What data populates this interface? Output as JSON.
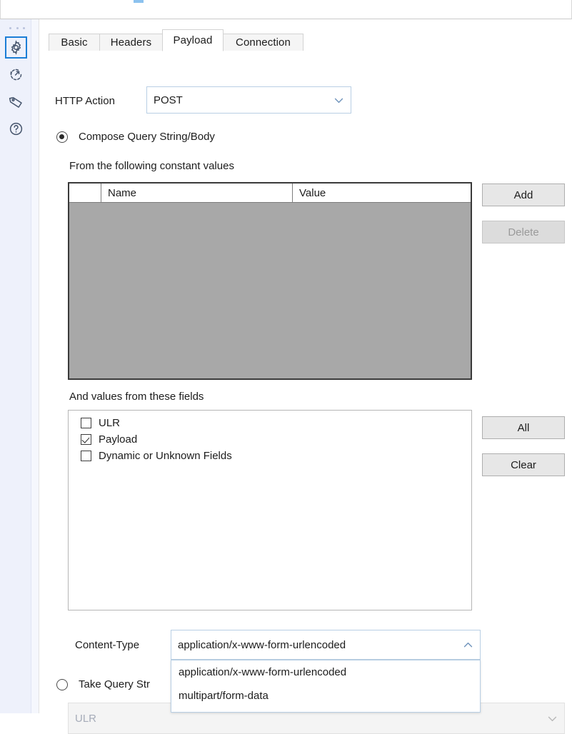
{
  "rail": {
    "handle": "drag-handle-dots",
    "items": [
      {
        "icon": "gear-icon",
        "selected": true
      },
      {
        "icon": "refresh-arrow-icon",
        "selected": false
      },
      {
        "icon": "tag-icon",
        "selected": false
      },
      {
        "icon": "help-circle-icon",
        "selected": false
      }
    ]
  },
  "tabs": [
    {
      "label": "Basic",
      "active": false
    },
    {
      "label": "Headers",
      "active": false
    },
    {
      "label": "Payload",
      "active": true
    },
    {
      "label": "Connection",
      "active": false
    }
  ],
  "http_action": {
    "label": "HTTP Action",
    "value": "POST",
    "chevron": "chevron-down-icon"
  },
  "compose_option": {
    "label": "Compose Query String/Body",
    "selected": true
  },
  "constants": {
    "caption": "From the following constant values",
    "columns": [
      "",
      "Name",
      "Value"
    ],
    "rows": [],
    "add_label": "Add",
    "delete_label": "Delete",
    "delete_enabled": false
  },
  "fields": {
    "caption": "And values from these fields",
    "items": [
      {
        "label": "ULR",
        "checked": false
      },
      {
        "label": "Payload",
        "checked": true
      },
      {
        "label": "Dynamic or Unknown Fields",
        "checked": false
      }
    ],
    "all_label": "All",
    "clear_label": "Clear"
  },
  "content_type": {
    "label": "Content-Type",
    "value": "application/x-www-form-urlencoded",
    "chevron": "chevron-up-icon",
    "expanded": true,
    "options": [
      "application/x-www-form-urlencoded",
      "multipart/form-data"
    ]
  },
  "take_query_option": {
    "label": "Take Query Str",
    "selected": false
  },
  "source_combo": {
    "placeholder": "ULR",
    "value": "",
    "chevron": "chevron-down-icon",
    "disabled": true
  },
  "colors": {
    "accent": "#1b7ed6",
    "rail_bg": "#eef1fb",
    "combo_border": "#b9cfe4",
    "table_body": "#a8a8a8"
  }
}
